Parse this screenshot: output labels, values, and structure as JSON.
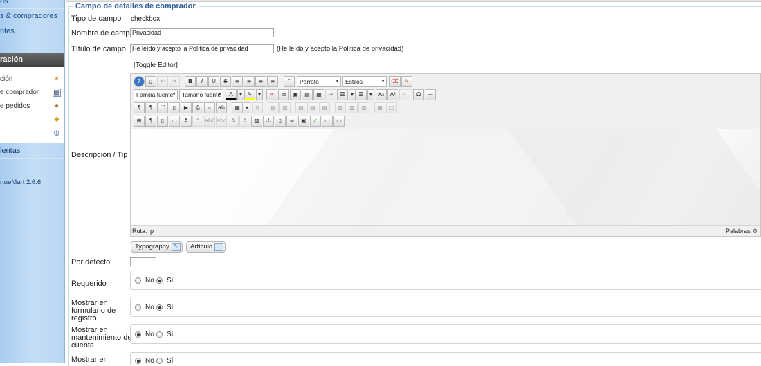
{
  "sidebar": {
    "top_links": [
      "os",
      "s & compradores",
      "ntes"
    ],
    "section_header": "ración",
    "panel_items": [
      "ción",
      "e comprador",
      "e pedidos"
    ],
    "bottom_header": "ientas",
    "version": "rtueMart 2.6.6"
  },
  "form": {
    "legend": "Campo de detalles de comprador",
    "field_type_label": "Tipo de campo",
    "field_type_value": "checkbox",
    "field_name_label": "Nombre de campo",
    "field_name_value": "Privacidad",
    "field_title_label": "Título de campo",
    "field_title_value": "He leído y acepto la Política de privacidad",
    "field_title_preview": "(He leído y acepto la Política de privacidad)",
    "toggle_editor": "[Toggle Editor]",
    "description_label": "Descripción / Tip",
    "default_label": "Por defecto",
    "default_value": "",
    "required_label": "Requerido",
    "show_register_label_1": "Mostrar en",
    "show_register_label_2": "formulario de",
    "show_register_label_3": "registro",
    "show_account_label_1": "Mostrar en",
    "show_account_label_2": "mantenimiento de",
    "show_account_label_3": "cuenta",
    "show_more_label": "Mostrar en",
    "no_label": "No",
    "yes_label": "Sí",
    "required_value": "Sí",
    "show_register_value": "Sí",
    "show_account_value": "No",
    "show_more_value": "No"
  },
  "editor": {
    "format_select": "Párrafo",
    "styles_select": "Estilos",
    "font_family_select": "Familia fuente",
    "font_size_select": "Tamaño fuente",
    "path_label": "Ruta:",
    "path_value": "p",
    "words_label": "Palabras:",
    "words_value": "0",
    "typography_button": "Typography",
    "article_button": "Artículo"
  }
}
